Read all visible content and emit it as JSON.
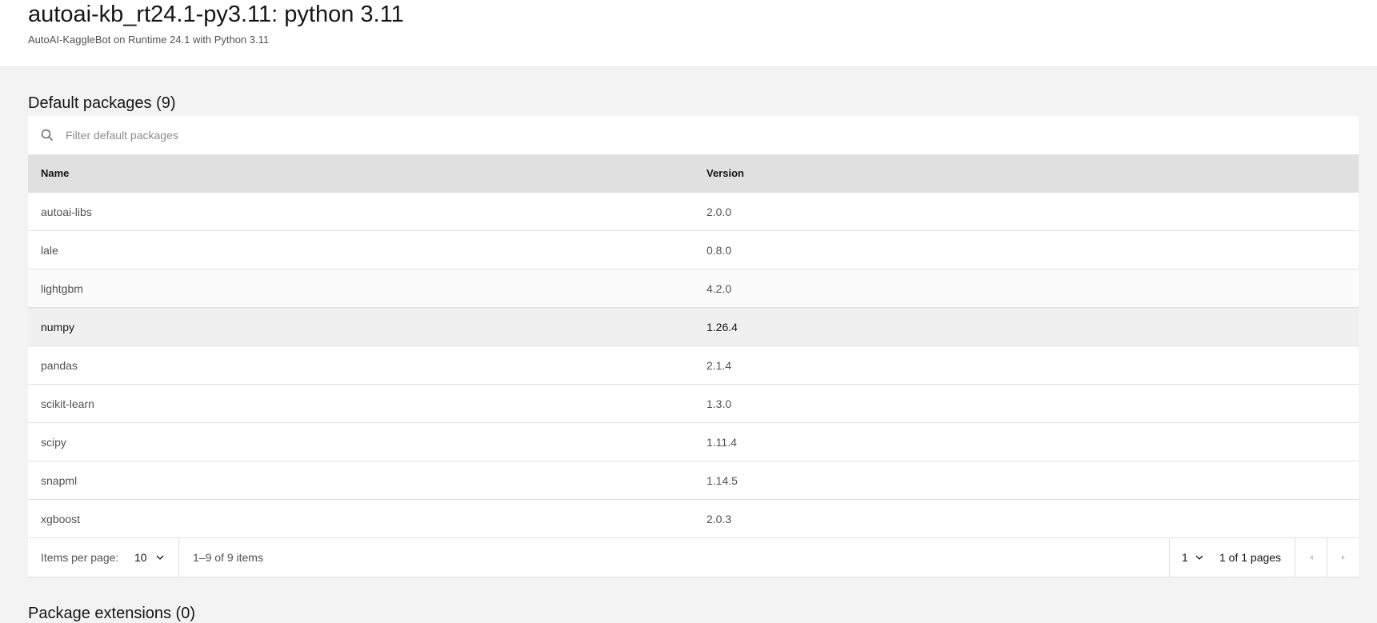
{
  "header": {
    "title": "autoai-kb_rt24.1-py3.11: python 3.11",
    "subtitle": "AutoAI-KaggleBot on Runtime 24.1 with Python 3.11"
  },
  "default_packages": {
    "title": "Default packages (9)",
    "search_placeholder": "Filter default packages",
    "columns": {
      "name": "Name",
      "version": "Version"
    },
    "rows": [
      {
        "name": "autoai-libs",
        "version": "2.0.0"
      },
      {
        "name": "lale",
        "version": "0.8.0"
      },
      {
        "name": "lightgbm",
        "version": "4.2.0"
      },
      {
        "name": "numpy",
        "version": "1.26.4"
      },
      {
        "name": "pandas",
        "version": "2.1.4"
      },
      {
        "name": "scikit-learn",
        "version": "1.3.0"
      },
      {
        "name": "scipy",
        "version": "1.11.4"
      },
      {
        "name": "snapml",
        "version": "1.14.5"
      },
      {
        "name": "xgboost",
        "version": "2.0.3"
      }
    ],
    "pagination": {
      "items_per_page_label": "Items per page:",
      "items_per_page_value": "10",
      "range_text": "1–9 of 9 items",
      "page_value": "1",
      "pages_text": "1 of 1 pages"
    }
  },
  "extensions": {
    "title": "Package extensions (0)"
  },
  "icons": {
    "search": "search-icon",
    "chevron": "chevron-down-icon",
    "prev": "caret-left-icon",
    "next": "caret-right-icon"
  }
}
